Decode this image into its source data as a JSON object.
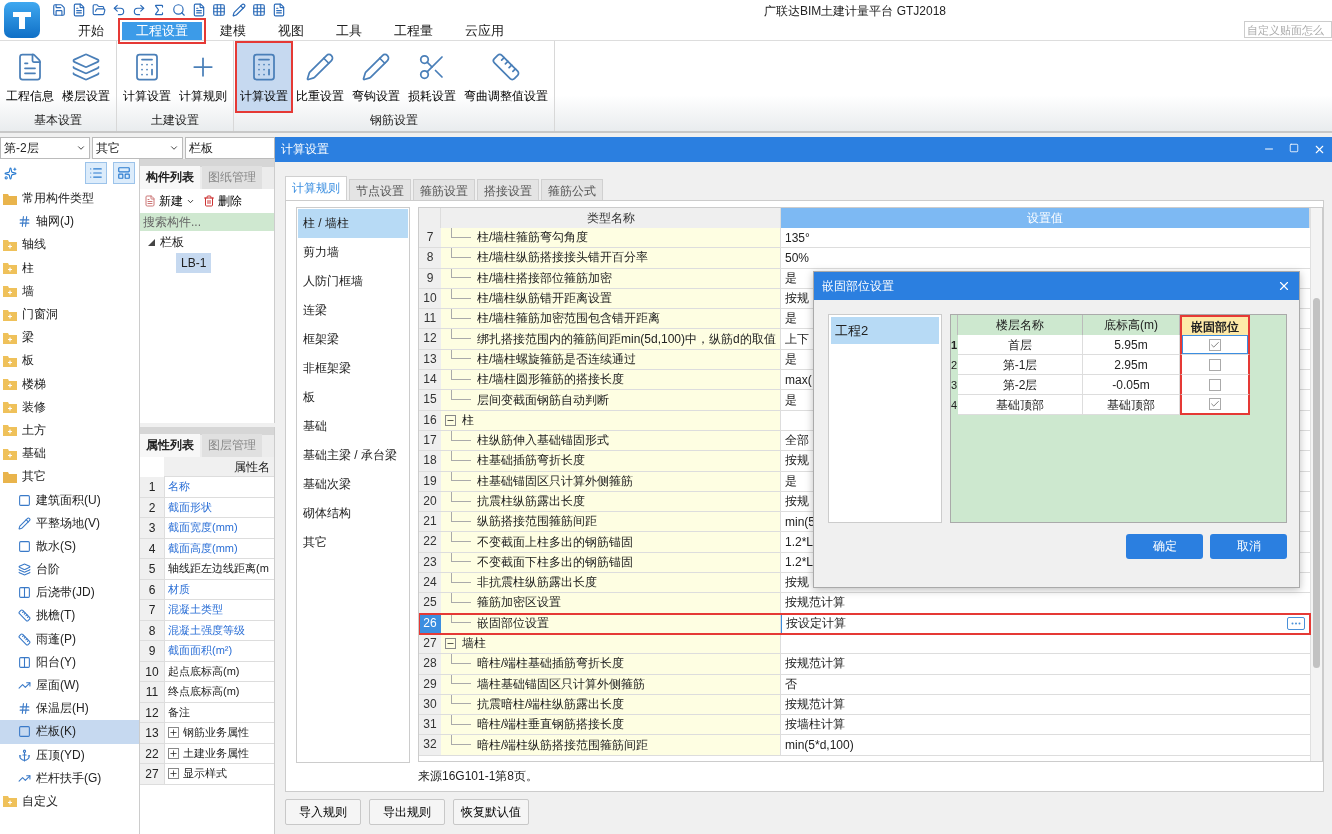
{
  "app": {
    "title": "广联达BIM土建计量平台 GTJ2018",
    "help_search": {
      "placeholder": "自定义贴面怎么"
    }
  },
  "menu_tabs": [
    {
      "label": "开始",
      "selected": false,
      "highlighted": false
    },
    {
      "label": "工程设置",
      "selected": true,
      "highlighted": true
    },
    {
      "label": "建模",
      "selected": false,
      "highlighted": false
    },
    {
      "label": "视图",
      "selected": false,
      "highlighted": false
    },
    {
      "label": "工具",
      "selected": false,
      "highlighted": false
    },
    {
      "label": "工程量",
      "selected": false,
      "highlighted": false
    },
    {
      "label": "云应用",
      "selected": false,
      "highlighted": false
    }
  ],
  "ribbon": {
    "groups": [
      {
        "title": "基本设置",
        "buttons": [
          {
            "label": "工程信息",
            "selected": false,
            "highlighted": false
          },
          {
            "label": "楼层设置",
            "selected": false,
            "highlighted": false
          }
        ]
      },
      {
        "title": "土建设置",
        "buttons": [
          {
            "label": "计算设置",
            "selected": false,
            "highlighted": false
          },
          {
            "label": "计算规则",
            "selected": false,
            "highlighted": false
          }
        ]
      },
      {
        "title": "钢筋设置",
        "buttons": [
          {
            "label": "计算设置",
            "selected": true,
            "highlighted": true
          },
          {
            "label": "比重设置",
            "selected": false,
            "highlighted": false
          },
          {
            "label": "弯钩设置",
            "selected": false,
            "highlighted": false
          },
          {
            "label": "损耗设置",
            "selected": false,
            "highlighted": false
          },
          {
            "label": "弯曲调整值设置",
            "selected": false,
            "highlighted": false
          }
        ]
      }
    ]
  },
  "filters": [
    "第-2层",
    "其它",
    "栏板"
  ],
  "sidebar": {
    "items": [
      {
        "label": "常用构件类型",
        "expanded": true,
        "children": [
          {
            "label": "轴网(J)",
            "selected": false
          }
        ]
      },
      {
        "label": "轴线",
        "expanded": false
      },
      {
        "label": "柱",
        "expanded": false
      },
      {
        "label": "墙",
        "expanded": false
      },
      {
        "label": "门窗洞",
        "expanded": false
      },
      {
        "label": "梁",
        "expanded": false
      },
      {
        "label": "板",
        "expanded": false
      },
      {
        "label": "楼梯",
        "expanded": false
      },
      {
        "label": "装修",
        "expanded": false
      },
      {
        "label": "土方",
        "expanded": false
      },
      {
        "label": "基础",
        "expanded": false
      },
      {
        "label": "其它",
        "expanded": true,
        "children": [
          {
            "label": "建筑面积(U)",
            "selected": false
          },
          {
            "label": "平整场地(V)",
            "selected": false
          },
          {
            "label": "散水(S)",
            "selected": false
          },
          {
            "label": "台阶",
            "selected": false
          },
          {
            "label": "后浇带(JD)",
            "selected": false
          },
          {
            "label": "挑檐(T)",
            "selected": false
          },
          {
            "label": "雨蓬(P)",
            "selected": false
          },
          {
            "label": "阳台(Y)",
            "selected": false
          },
          {
            "label": "屋面(W)",
            "selected": false
          },
          {
            "label": "保温层(H)",
            "selected": false
          },
          {
            "label": "栏板(K)",
            "selected": true
          },
          {
            "label": "压顶(YD)",
            "selected": false
          },
          {
            "label": "栏杆扶手(G)",
            "selected": false
          }
        ]
      },
      {
        "label": "自定义",
        "expanded": false
      }
    ]
  },
  "component_panel": {
    "tabs": [
      {
        "label": "构件列表",
        "selected": true
      },
      {
        "label": "图纸管理",
        "selected": false
      }
    ],
    "actions": [
      "新建",
      "删除"
    ],
    "search": {
      "placeholder": "搜索构件..."
    },
    "tree": [
      {
        "label": "栏板",
        "expanded": true,
        "children": [
          {
            "label": "LB-1",
            "selected": true
          }
        ]
      }
    ]
  },
  "property_panel": {
    "tabs": [
      {
        "label": "属性列表",
        "selected": true
      },
      {
        "label": "图层管理",
        "selected": false
      }
    ],
    "header": "属性名",
    "rows": [
      {
        "index": "1",
        "name": "名称",
        "kind": "required"
      },
      {
        "index": "2",
        "name": "截面形状",
        "kind": "required"
      },
      {
        "index": "3",
        "name": "截面宽度(mm)",
        "kind": "required"
      },
      {
        "index": "4",
        "name": "截面高度(mm)",
        "kind": "required"
      },
      {
        "index": "5",
        "name": "轴线距左边线距离(m",
        "kind": "plain"
      },
      {
        "index": "6",
        "name": "材质",
        "kind": "required"
      },
      {
        "index": "7",
        "name": "混凝土类型",
        "kind": "required"
      },
      {
        "index": "8",
        "name": "混凝土强度等级",
        "kind": "required"
      },
      {
        "index": "9",
        "name": "截面面积(m²)",
        "kind": "required"
      },
      {
        "index": "10",
        "name": "起点底标高(m)",
        "kind": "plain"
      },
      {
        "index": "11",
        "name": "终点底标高(m)",
        "kind": "plain"
      },
      {
        "index": "12",
        "name": "备注",
        "kind": "plain"
      },
      {
        "index": "13",
        "name": "钢筋业务属性",
        "kind": "group"
      },
      {
        "index": "22",
        "name": "土建业务属性",
        "kind": "group"
      },
      {
        "index": "27",
        "name": "显示样式",
        "kind": "group"
      }
    ]
  },
  "settings_window": {
    "title": "计算设置",
    "tabs": [
      {
        "label": "计算规则",
        "selected": true
      },
      {
        "label": "节点设置",
        "selected": false
      },
      {
        "label": "箍筋设置",
        "selected": false
      },
      {
        "label": "搭接设置",
        "selected": false
      },
      {
        "label": "箍筋公式",
        "selected": false
      }
    ],
    "categories": [
      {
        "label": "柱 / 墙柱",
        "selected": true
      },
      {
        "label": "剪力墙",
        "selected": false
      },
      {
        "label": "人防门框墙",
        "selected": false
      },
      {
        "label": "连梁",
        "selected": false
      },
      {
        "label": "框架梁",
        "selected": false
      },
      {
        "label": "非框架梁",
        "selected": false
      },
      {
        "label": "板",
        "selected": false
      },
      {
        "label": "基础",
        "selected": false
      },
      {
        "label": "基础主梁 / 承台梁",
        "selected": false
      },
      {
        "label": "基础次梁",
        "selected": false
      },
      {
        "label": "砌体结构",
        "selected": false
      },
      {
        "label": "其它",
        "selected": false
      }
    ],
    "table": {
      "columns": [
        "类型名称",
        "设置值"
      ],
      "rows": [
        {
          "index": "7",
          "kind": "item",
          "name": "柱/墙柱箍筋弯勾角度",
          "value": "135°"
        },
        {
          "index": "8",
          "kind": "item",
          "name": "柱/墙柱纵筋搭接接头错开百分率",
          "value": "50%"
        },
        {
          "index": "9",
          "kind": "item",
          "name": "柱/墙柱搭接部位箍筋加密",
          "value": "是"
        },
        {
          "index": "10",
          "kind": "item",
          "name": "柱/墙柱纵筋错开距离设置",
          "value": "按规"
        },
        {
          "index": "11",
          "kind": "item",
          "name": "柱/墙柱箍筋加密范围包含错开距离",
          "value": "是"
        },
        {
          "index": "12",
          "kind": "item",
          "name": "绑扎搭接范围内的箍筋间距min(5d,100)中，纵筋d的取值",
          "value": "上下"
        },
        {
          "index": "13",
          "kind": "item",
          "name": "柱/墙柱螺旋箍筋是否连续通过",
          "value": "是"
        },
        {
          "index": "14",
          "kind": "item",
          "name": "柱/墙柱圆形箍筋的搭接长度",
          "value": "max("
        },
        {
          "index": "15",
          "kind": "item",
          "name": "层间变截面钢筋自动判断",
          "value": "是"
        },
        {
          "index": "16",
          "kind": "group",
          "name": "柱",
          "expanded": true
        },
        {
          "index": "17",
          "kind": "item",
          "name": "柱纵筋伸入基础锚固形式",
          "value": "全部"
        },
        {
          "index": "18",
          "kind": "item",
          "name": "柱基础插筋弯折长度",
          "value": "按规"
        },
        {
          "index": "19",
          "kind": "item",
          "name": "柱基础锚固区只计算外侧箍筋",
          "value": "是"
        },
        {
          "index": "20",
          "kind": "item",
          "name": "抗震柱纵筋露出长度",
          "value": "按规"
        },
        {
          "index": "21",
          "kind": "item",
          "name": "纵筋搭接范围箍筋间距",
          "value": "min(5"
        },
        {
          "index": "22",
          "kind": "item",
          "name": "不变截面上柱多出的钢筋锚固",
          "value": "1.2*L"
        },
        {
          "index": "23",
          "kind": "item",
          "name": "不变截面下柱多出的钢筋锚固",
          "value": "1.2*L"
        },
        {
          "index": "24",
          "kind": "item",
          "name": "非抗震柱纵筋露出长度",
          "value": "按规"
        },
        {
          "index": "25",
          "kind": "item",
          "name": "箍筋加密区设置",
          "value": "按规范计算"
        },
        {
          "index": "26",
          "kind": "item",
          "name": "嵌固部位设置",
          "value": "按设定计算",
          "selected": true,
          "highlighted": true
        },
        {
          "index": "27",
          "kind": "group",
          "name": "墙柱",
          "expanded": true
        },
        {
          "index": "28",
          "kind": "item",
          "name": "暗柱/端柱基础插筋弯折长度",
          "value": "按规范计算"
        },
        {
          "index": "29",
          "kind": "item",
          "name": "墙柱基础锚固区只计算外侧箍筋",
          "value": "否"
        },
        {
          "index": "30",
          "kind": "item",
          "name": "抗震暗柱/端柱纵筋露出长度",
          "value": "按规范计算"
        },
        {
          "index": "31",
          "kind": "item",
          "name": "暗柱/端柱垂直钢筋搭接长度",
          "value": "按墙柱计算"
        },
        {
          "index": "32",
          "kind": "item",
          "name": "暗柱/端柱纵筋搭接范围箍筋间距",
          "value": "min(5*d,100)"
        }
      ]
    },
    "source_note": "来源16G101-1第8页。",
    "buttons": [
      "导入规则",
      "导出规则",
      "恢复默认值"
    ]
  },
  "dialog": {
    "title": "嵌固部位设置",
    "projects": [
      {
        "label": "工程2",
        "selected": true
      }
    ],
    "columns": [
      {
        "label": "楼层名称",
        "highlighted": false
      },
      {
        "label": "底标高(m)",
        "highlighted": false
      },
      {
        "label": "嵌固部位",
        "highlighted": true
      }
    ],
    "rows": [
      {
        "index": "1",
        "floor": "首层",
        "elevation": "5.95m",
        "embedded": true,
        "selected": true
      },
      {
        "index": "2",
        "floor": "第-1层",
        "elevation": "2.95m",
        "embedded": false,
        "selected": false
      },
      {
        "index": "3",
        "floor": "第-2层",
        "elevation": "-0.05m",
        "embedded": false,
        "selected": false
      },
      {
        "index": "4",
        "floor": "基础顶部",
        "elevation": "基础顶部",
        "embedded": true,
        "selected": false
      }
    ],
    "buttons": [
      "确定",
      "取消"
    ]
  }
}
